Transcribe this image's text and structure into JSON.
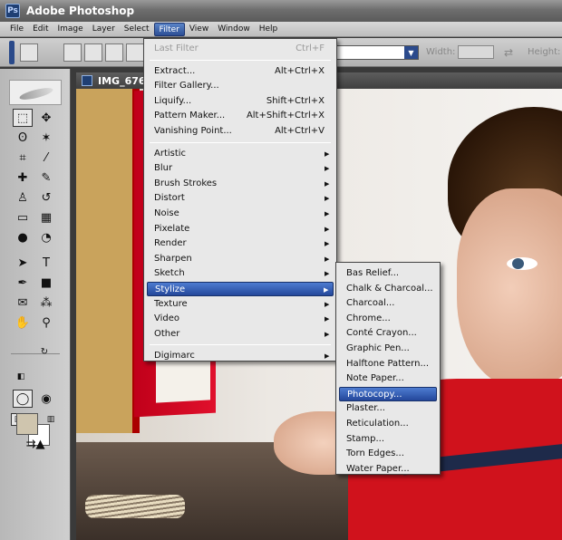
{
  "app": {
    "title": "Adobe Photoshop",
    "logo_text": "Ps"
  },
  "menubar": [
    "File",
    "Edit",
    "Image",
    "Layer",
    "Select",
    "Filter",
    "View",
    "Window",
    "Help"
  ],
  "menubar_active": "Filter",
  "options": {
    "width_label": "Width:",
    "height_label": "Height:",
    "swap_symbol": "⇄"
  },
  "document": {
    "tab_title": "IMG_676"
  },
  "filter_menu": {
    "groups": [
      [
        {
          "label": "Last Filter",
          "shortcut": "Ctrl+F",
          "disabled": true
        }
      ],
      [
        {
          "label": "Extract...",
          "shortcut": "Alt+Ctrl+X"
        },
        {
          "label": "Filter Gallery..."
        },
        {
          "label": "Liquify...",
          "shortcut": "Shift+Ctrl+X"
        },
        {
          "label": "Pattern Maker...",
          "shortcut": "Alt+Shift+Ctrl+X"
        },
        {
          "label": "Vanishing Point...",
          "shortcut": "Alt+Ctrl+V"
        }
      ],
      [
        {
          "label": "Artistic",
          "submenu": true
        },
        {
          "label": "Blur",
          "submenu": true
        },
        {
          "label": "Brush Strokes",
          "submenu": true
        },
        {
          "label": "Distort",
          "submenu": true
        },
        {
          "label": "Noise",
          "submenu": true
        },
        {
          "label": "Pixelate",
          "submenu": true
        },
        {
          "label": "Render",
          "submenu": true
        },
        {
          "label": "Sharpen",
          "submenu": true
        },
        {
          "label": "Sketch",
          "submenu": true
        },
        {
          "label": "Stylize",
          "submenu": true,
          "highlighted": true
        },
        {
          "label": "Texture",
          "submenu": true
        },
        {
          "label": "Video",
          "submenu": true
        },
        {
          "label": "Other",
          "submenu": true
        }
      ],
      [
        {
          "label": "Digimarc",
          "submenu": true
        }
      ]
    ]
  },
  "submenu_arrow": "▶",
  "stylize_submenu": {
    "items": [
      "Bas Relief...",
      "Chalk & Charcoal...",
      "Charcoal...",
      "Chrome...",
      "Conté Crayon...",
      "Graphic Pen...",
      "Halftone Pattern...",
      "Note Paper...",
      "Photocopy...",
      "Plaster...",
      "Reticulation...",
      "Stamp...",
      "Torn Edges...",
      "Water Paper..."
    ],
    "highlighted": "Photocopy..."
  },
  "tools": [
    {
      "icon": "marquee-icon",
      "glyph": "⬚"
    },
    {
      "icon": "move-icon",
      "glyph": "✥"
    },
    {
      "icon": "lasso-icon",
      "glyph": "ʘ"
    },
    {
      "icon": "magic-wand-icon",
      "glyph": "✶"
    },
    {
      "icon": "crop-icon",
      "glyph": "⌗"
    },
    {
      "icon": "slice-icon",
      "glyph": "⁄"
    },
    {
      "icon": "healing-brush-icon",
      "glyph": "✚"
    },
    {
      "icon": "brush-icon",
      "glyph": "✎"
    },
    {
      "icon": "clone-stamp-icon",
      "glyph": "♙"
    },
    {
      "icon": "history-brush-icon",
      "glyph": "↺"
    },
    {
      "icon": "eraser-icon",
      "glyph": "▭"
    },
    {
      "icon": "gradient-icon",
      "glyph": "▦"
    },
    {
      "icon": "blur-icon",
      "glyph": "●"
    },
    {
      "icon": "dodge-icon",
      "glyph": "◔"
    },
    {
      "icon": "path-selection-icon",
      "glyph": "➤"
    },
    {
      "icon": "type-icon",
      "glyph": "T"
    },
    {
      "icon": "pen-icon",
      "glyph": "✒"
    },
    {
      "icon": "shape-icon",
      "glyph": "■"
    },
    {
      "icon": "notes-icon",
      "glyph": "✉"
    },
    {
      "icon": "eyedropper-icon",
      "glyph": "⁂"
    },
    {
      "icon": "hand-icon",
      "glyph": "✋"
    },
    {
      "icon": "zoom-icon",
      "glyph": "⚲"
    }
  ]
}
